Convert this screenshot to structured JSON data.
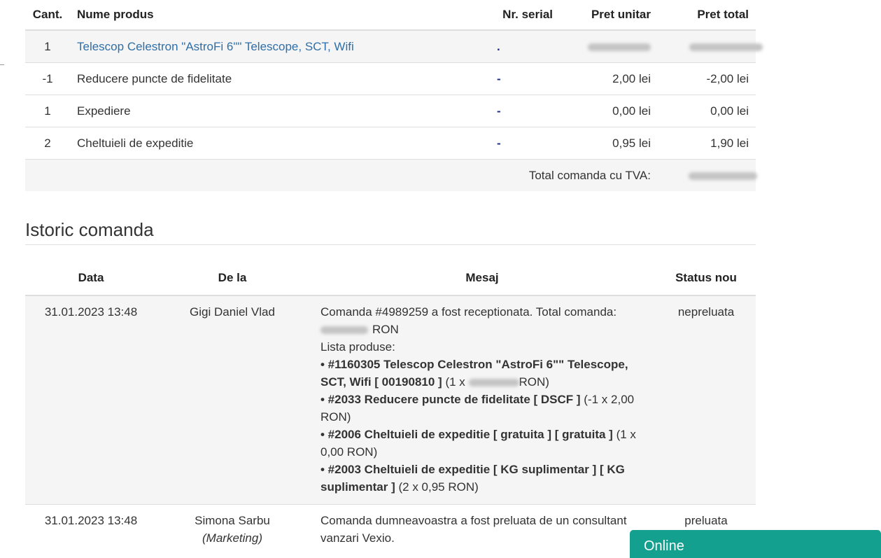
{
  "products_table": {
    "headers": {
      "qty": "Cant.",
      "name": "Nume produs",
      "serial": "Nr. serial",
      "unit_price": "Pret unitar",
      "total_price": "Pret total"
    },
    "rows": [
      {
        "qty": "1",
        "name": "Telescop Celestron \"AstroFi 6\"\" Telescope, SCT, Wifi",
        "serial": ".",
        "unit_price": "",
        "total_price": "",
        "link": true
      },
      {
        "qty": "-1",
        "name": "Reducere puncte de fidelitate",
        "serial": "-",
        "unit_price": "2,00 lei",
        "total_price": "-2,00 lei"
      },
      {
        "qty": "1",
        "name": "Expediere",
        "serial": "-",
        "unit_price": "0,00 lei",
        "total_price": "0,00 lei"
      },
      {
        "qty": "2",
        "name": "Cheltuieli de expeditie",
        "serial": "-",
        "unit_price": "0,95 lei",
        "total_price": "1,90 lei"
      }
    ],
    "total_label": "Total comanda cu TVA:",
    "total_value": ""
  },
  "history": {
    "title": "Istoric comanda",
    "headers": {
      "date": "Data",
      "from": "De la",
      "message": "Mesaj",
      "status": "Status nou"
    },
    "rows": [
      {
        "date": "31.01.2023 13:48",
        "from": "Gigi Daniel Vlad",
        "status": "nepreluata",
        "message": {
          "intro": "Comanda #4989259 a fost receptionata. Total comanda:",
          "total_suffix": "RON",
          "list_label": "Lista produse:",
          "items": [
            {
              "bold": "• #1160305 Telescop Celestron \"AstroFi 6\"\" Telescope, SCT, Wifi [ 00190810 ]",
              "pre": "(1 x",
              "post": "RON)",
              "redacted": true
            },
            {
              "bold": "• #2033 Reducere puncte de fidelitate [ DSCF ]",
              "tail": "(-1 x 2,00 RON)"
            },
            {
              "bold": "• #2006 Cheltuieli de expeditie [ gratuita ] [ gratuita ]",
              "tail": "(1 x 0,00 RON)"
            },
            {
              "bold": "• #2003 Cheltuieli de expeditie [ KG suplimentar ] [ KG suplimentar ]",
              "tail": "(2 x 0,95 RON)"
            }
          ]
        }
      },
      {
        "date": "31.01.2023 13:48",
        "from": "Simona Sarbu",
        "from_role": "(Marketing)",
        "status": "preluata",
        "message_text": "Comanda dumneavoastra a fost preluata de un consultant vanzari Vexio."
      }
    ]
  },
  "chat": {
    "label": "Online",
    "color": "#13a08f"
  }
}
